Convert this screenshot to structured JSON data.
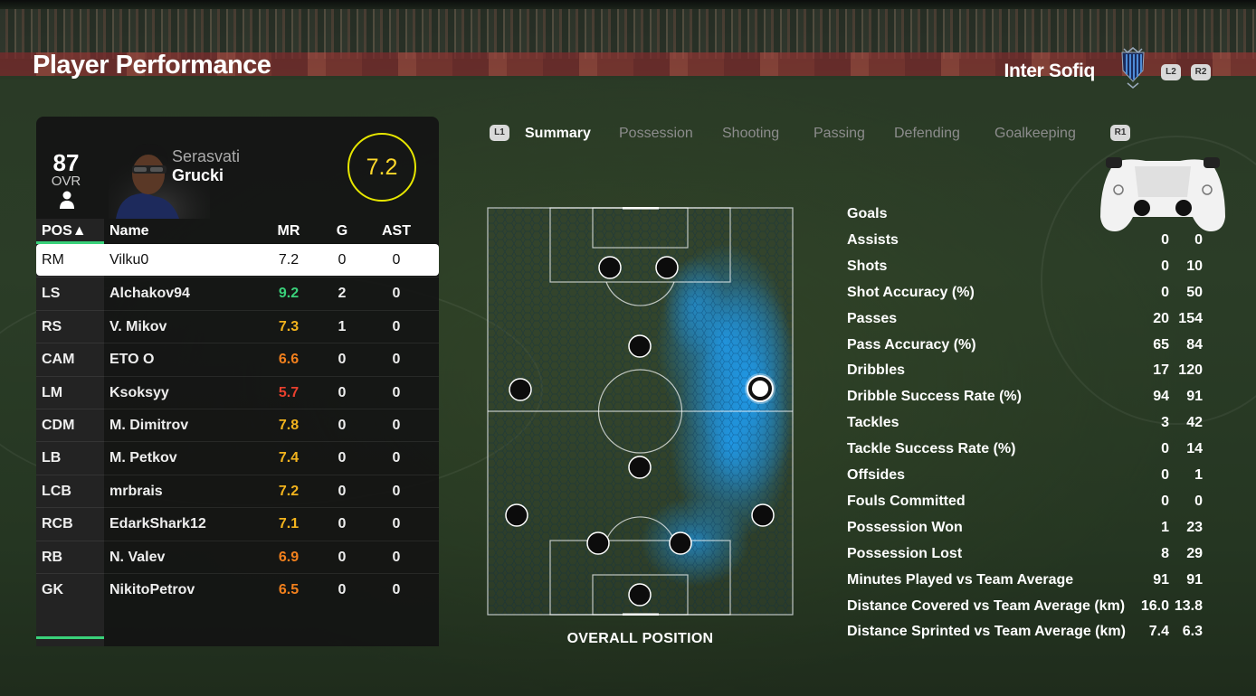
{
  "header": {
    "title": "Player Performance",
    "team_name": "Inter Sofiq",
    "buttons": {
      "l2": "L2",
      "r2": "R2",
      "l1": "L1",
      "r1": "R1"
    }
  },
  "player": {
    "ovr": "87",
    "ovr_label": "OVR",
    "first_name": "Serasvati",
    "last_name": "Grucki",
    "match_rating": "7.2"
  },
  "table": {
    "headers": {
      "pos": "POS▲",
      "name": "Name",
      "mr": "MR",
      "g": "G",
      "ast": "AST"
    },
    "rows": [
      {
        "pos": "RM",
        "name": "Vilku0",
        "mr": "7.2",
        "g": "0",
        "ast": "0",
        "mr_color": "#111111"
      },
      {
        "pos": "LS",
        "name": "Alchakov94",
        "mr": "9.2",
        "g": "2",
        "ast": "0",
        "mr_color": "#3ad17a"
      },
      {
        "pos": "RS",
        "name": "V. Mikov",
        "mr": "7.3",
        "g": "1",
        "ast": "0",
        "mr_color": "#f2b31d"
      },
      {
        "pos": "CAM",
        "name": "ETO O",
        "mr": "6.6",
        "g": "0",
        "ast": "0",
        "mr_color": "#f2801d"
      },
      {
        "pos": "LM",
        "name": "Ksoksyy",
        "mr": "5.7",
        "g": "0",
        "ast": "0",
        "mr_color": "#e8402e"
      },
      {
        "pos": "CDM",
        "name": "M. Dimitrov",
        "mr": "7.8",
        "g": "0",
        "ast": "0",
        "mr_color": "#f2b31d"
      },
      {
        "pos": "LB",
        "name": "M. Petkov",
        "mr": "7.4",
        "g": "0",
        "ast": "0",
        "mr_color": "#f2b31d"
      },
      {
        "pos": "LCB",
        "name": "mrbrais",
        "mr": "7.2",
        "g": "0",
        "ast": "0",
        "mr_color": "#f2b31d"
      },
      {
        "pos": "RCB",
        "name": "EdarkShark12",
        "mr": "7.1",
        "g": "0",
        "ast": "0",
        "mr_color": "#f2b31d"
      },
      {
        "pos": "RB",
        "name": "N. Valev",
        "mr": "6.9",
        "g": "0",
        "ast": "0",
        "mr_color": "#f2801d"
      },
      {
        "pos": "GK",
        "name": "NikitoPetrov",
        "mr": "6.5",
        "g": "0",
        "ast": "0",
        "mr_color": "#f2801d"
      }
    ]
  },
  "tabs": [
    "Summary",
    "Possession",
    "Shooting",
    "Passing",
    "Defending",
    "Goalkeeping"
  ],
  "active_tab": "Summary",
  "pitch": {
    "caption": "OVERALL POSITION"
  },
  "stats": {
    "rows": [
      {
        "label": "Goals",
        "a": "",
        "b": ""
      },
      {
        "label": "Assists",
        "a": "0",
        "b": "0"
      },
      {
        "label": "Shots",
        "a": "0",
        "b": "10"
      },
      {
        "label": "Shot Accuracy (%)",
        "a": "0",
        "b": "50"
      },
      {
        "label": "Passes",
        "a": "20",
        "b": "154"
      },
      {
        "label": "Pass Accuracy (%)",
        "a": "65",
        "b": "84"
      },
      {
        "label": "Dribbles",
        "a": "17",
        "b": "120"
      },
      {
        "label": "Dribble Success Rate (%)",
        "a": "94",
        "b": "91"
      },
      {
        "label": "Tackles",
        "a": "3",
        "b": "42"
      },
      {
        "label": "Tackle Success Rate (%)",
        "a": "0",
        "b": "14"
      },
      {
        "label": "Offsides",
        "a": "0",
        "b": "1"
      },
      {
        "label": "Fouls Committed",
        "a": "0",
        "b": "0"
      },
      {
        "label": "Possession Won",
        "a": "1",
        "b": "23"
      },
      {
        "label": "Possession Lost",
        "a": "8",
        "b": "29"
      },
      {
        "label": "Minutes Played vs Team Average",
        "a": "91",
        "b": "91"
      },
      {
        "label": "Distance Covered vs Team Average (km)",
        "a": "16.0",
        "b": "13.8"
      },
      {
        "label": "Distance Sprinted vs Team Average (km)",
        "a": "7.4",
        "b": "6.3"
      }
    ]
  },
  "colors": {
    "accent_green": "#3ad17a",
    "rating_ring": "#e6e600",
    "heatmap": "#1e9cf0"
  }
}
